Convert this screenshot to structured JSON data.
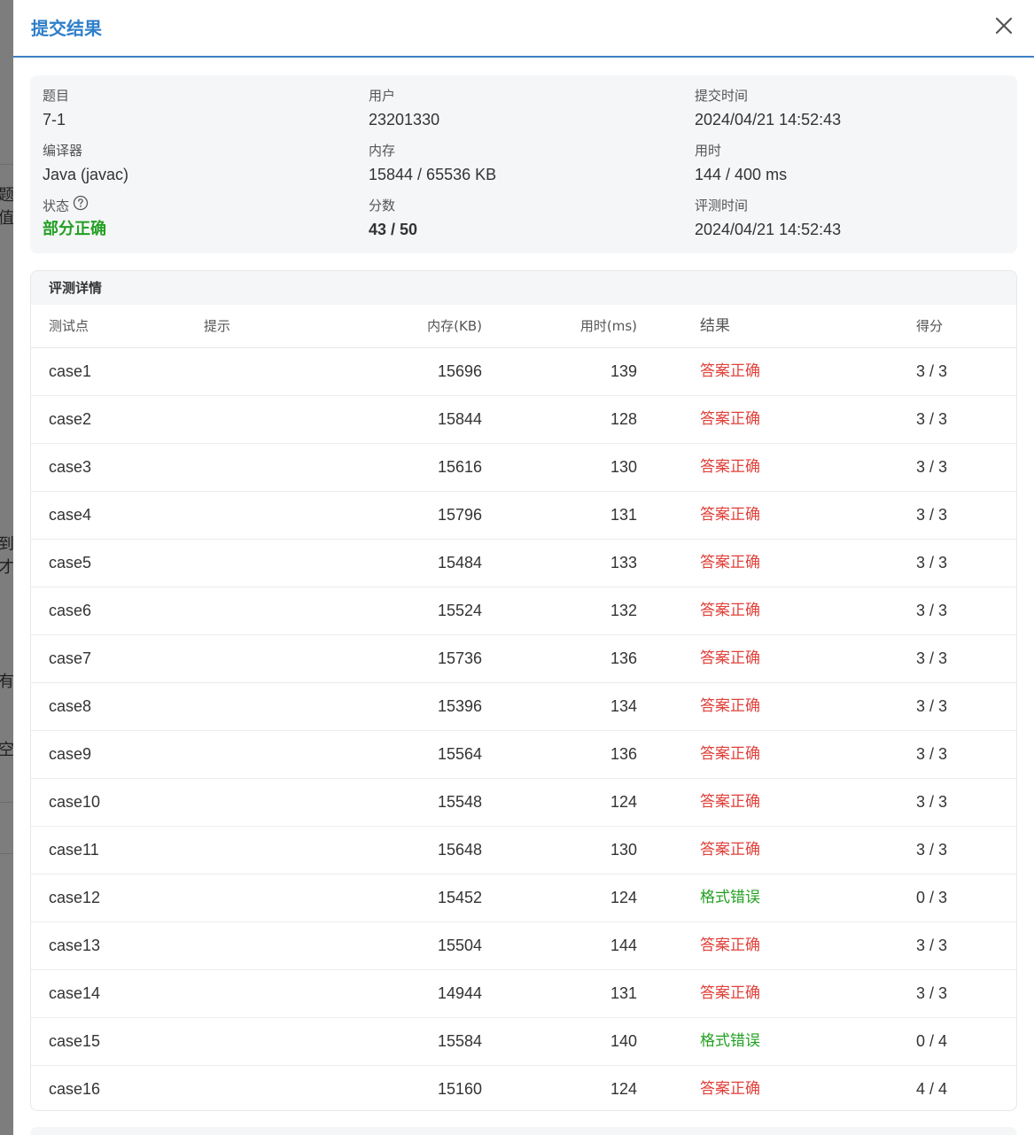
{
  "background_fragments": [
    "题值",
    "到才",
    "有",
    "空"
  ],
  "modal": {
    "title": "提交结果",
    "close_icon": "close-icon"
  },
  "info": {
    "problem_label": "题目",
    "problem_value": "7-1",
    "user_label": "用户",
    "user_value": "23201330",
    "submit_time_label": "提交时间",
    "submit_time_value": "2024/04/21 14:52:43",
    "compiler_label": "编译器",
    "compiler_value": "Java (javac)",
    "memory_label": "内存",
    "memory_value": "15844 / 65536 KB",
    "time_label": "用时",
    "time_value": "144 / 400 ms",
    "status_label": "状态",
    "status_help_icon": "question-circle-icon",
    "status_value": "部分正确",
    "score_label": "分数",
    "score_value": "43 / 50",
    "judge_time_label": "评测时间",
    "judge_time_value": "2024/04/21 14:52:43"
  },
  "details": {
    "title": "评测详情",
    "columns": {
      "case": "测试点",
      "hint": "提示",
      "memory": "内存(KB)",
      "time": "用时(ms)",
      "result": "结果",
      "score": "得分"
    },
    "rows": [
      {
        "case": "case1",
        "hint": "",
        "memory": "15696",
        "time": "139",
        "result": "答案正确",
        "score": "3 / 3"
      },
      {
        "case": "case2",
        "hint": "",
        "memory": "15844",
        "time": "128",
        "result": "答案正确",
        "score": "3 / 3"
      },
      {
        "case": "case3",
        "hint": "",
        "memory": "15616",
        "time": "130",
        "result": "答案正确",
        "score": "3 / 3"
      },
      {
        "case": "case4",
        "hint": "",
        "memory": "15796",
        "time": "131",
        "result": "答案正确",
        "score": "3 / 3"
      },
      {
        "case": "case5",
        "hint": "",
        "memory": "15484",
        "time": "133",
        "result": "答案正确",
        "score": "3 / 3"
      },
      {
        "case": "case6",
        "hint": "",
        "memory": "15524",
        "time": "132",
        "result": "答案正确",
        "score": "3 / 3"
      },
      {
        "case": "case7",
        "hint": "",
        "memory": "15736",
        "time": "136",
        "result": "答案正确",
        "score": "3 / 3"
      },
      {
        "case": "case8",
        "hint": "",
        "memory": "15396",
        "time": "134",
        "result": "答案正确",
        "score": "3 / 3"
      },
      {
        "case": "case9",
        "hint": "",
        "memory": "15564",
        "time": "136",
        "result": "答案正确",
        "score": "3 / 3"
      },
      {
        "case": "case10",
        "hint": "",
        "memory": "15548",
        "time": "124",
        "result": "答案正确",
        "score": "3 / 3"
      },
      {
        "case": "case11",
        "hint": "",
        "memory": "15648",
        "time": "130",
        "result": "答案正确",
        "score": "3 / 3"
      },
      {
        "case": "case12",
        "hint": "",
        "memory": "15452",
        "time": "124",
        "result": "格式错误",
        "score": "0 / 3"
      },
      {
        "case": "case13",
        "hint": "",
        "memory": "15504",
        "time": "144",
        "result": "答案正确",
        "score": "3 / 3"
      },
      {
        "case": "case14",
        "hint": "",
        "memory": "14944",
        "time": "131",
        "result": "答案正确",
        "score": "3 / 3"
      },
      {
        "case": "case15",
        "hint": "",
        "memory": "15584",
        "time": "140",
        "result": "格式错误",
        "score": "0 / 4"
      },
      {
        "case": "case16",
        "hint": "",
        "memory": "15160",
        "time": "124",
        "result": "答案正确",
        "score": "4 / 4"
      }
    ]
  },
  "colors": {
    "accent": "#2f7fc9",
    "accepted": "#e0403a",
    "format_error": "#22a022",
    "partial": "#22a022"
  }
}
